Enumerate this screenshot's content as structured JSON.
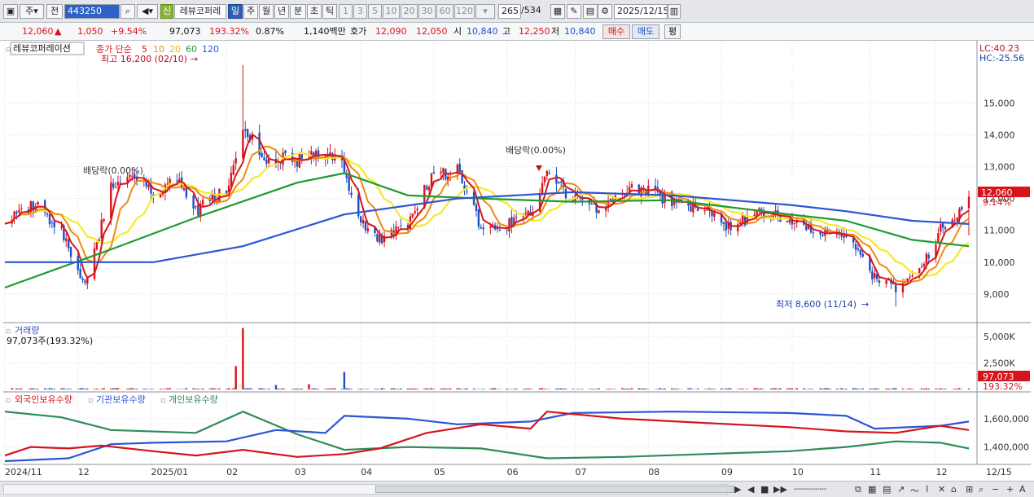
{
  "toolbar": {
    "market": "주",
    "prev": "전",
    "code": "443250",
    "new_badge": "신",
    "stock_name": "레뷰코퍼레",
    "periods": [
      "일",
      "주",
      "월",
      "년",
      "분",
      "초",
      "틱"
    ],
    "active_period": "일",
    "intervals": [
      "1",
      "3",
      "5",
      "10",
      "20",
      "30",
      "60",
      "120"
    ],
    "count": "265",
    "total": "/534",
    "date": "2025/12/15"
  },
  "quote": {
    "price": "12,060",
    "change": "1,050",
    "change_pct": "+9.54%",
    "volume": "97,073",
    "volume_ratio": "193.32%",
    "turnover_pct": "0.87%",
    "amount": "1,140백만",
    "ask_label": "호가",
    "ask1": "12,090",
    "ask2": "12,050",
    "open_label": "시",
    "open": "10,840",
    "high_label": "고",
    "high": "12,250",
    "low_label": "저",
    "low": "10,840",
    "buy_label": "매수",
    "sell_label": "매도",
    "flat_label": "평"
  },
  "colors": {
    "up": "#d7141b",
    "down": "#1f4fc4",
    "ma5": "#d7141b",
    "ma10": "#f08a0c",
    "ma20": "#f5ea2a",
    "ma60": "#1d9a34",
    "ma120": "#2d55d4",
    "foreign": "#d7141b",
    "institution": "#2d55d4",
    "individual": "#2e8b57"
  },
  "chart_data": [
    {
      "type": "candlestick",
      "title": "레뷰코퍼레이션",
      "legend_prefix": "종가 단순",
      "ma_periods": [
        "5",
        "10",
        "20",
        "60",
        "120"
      ],
      "y_ticks": [
        "9,000",
        "10,000",
        "11,000",
        "12,000",
        "13,000",
        "14,000",
        "15,000"
      ],
      "ylim": [
        8200,
        16400
      ],
      "current_price": "12,060",
      "current_change": "9.14%",
      "lc": "LC:40.23",
      "hc": "HC:-25.56",
      "annotations": {
        "high": "최고 16,200 (02/10)",
        "low": "최저 8,600 (11/14)",
        "dividend1": "배당락(0.00%)",
        "dividend2": "배당락(0.00%)"
      },
      "keypoints": [
        {
          "date": "2024-11-01",
          "close": 11400
        },
        {
          "date": "2024-11-14",
          "close": 11800
        },
        {
          "date": "2024-11-25",
          "close": 11000
        },
        {
          "date": "2024-12-05",
          "close": 9200
        },
        {
          "date": "2024-12-10",
          "close": 10600
        },
        {
          "date": "2024-12-16",
          "close": 12300
        },
        {
          "date": "2024-12-24",
          "close": 12600
        },
        {
          "date": "2025-01-03",
          "close": 12200
        },
        {
          "date": "2025-01-14",
          "close": 12700
        },
        {
          "date": "2025-01-21",
          "close": 11600
        },
        {
          "date": "2025-02-03",
          "close": 12300
        },
        {
          "date": "2025-02-10",
          "close": 14200
        },
        {
          "date": "2025-02-20",
          "close": 13300
        },
        {
          "date": "2025-03-05",
          "close": 13200
        },
        {
          "date": "2025-03-17",
          "close": 13500
        },
        {
          "date": "2025-03-25",
          "close": 12900
        },
        {
          "date": "2025-04-01",
          "close": 11300
        },
        {
          "date": "2025-04-09",
          "close": 10700
        },
        {
          "date": "2025-04-21",
          "close": 11200
        },
        {
          "date": "2025-04-29",
          "close": 12500
        },
        {
          "date": "2025-05-12",
          "close": 13000
        },
        {
          "date": "2025-05-22",
          "close": 11100
        },
        {
          "date": "2025-06-03",
          "close": 11200
        },
        {
          "date": "2025-06-12",
          "close": 11600
        },
        {
          "date": "2025-06-19",
          "close": 12800
        },
        {
          "date": "2025-06-30",
          "close": 12000
        },
        {
          "date": "2025-07-09",
          "close": 11700
        },
        {
          "date": "2025-07-21",
          "close": 12200
        },
        {
          "date": "2025-07-30",
          "close": 12300
        },
        {
          "date": "2025-08-11",
          "close": 11900
        },
        {
          "date": "2025-08-25",
          "close": 11600
        },
        {
          "date": "2025-09-05",
          "close": 11100
        },
        {
          "date": "2025-09-17",
          "close": 11600
        },
        {
          "date": "2025-09-30",
          "close": 11400
        },
        {
          "date": "2025-10-13",
          "close": 11000
        },
        {
          "date": "2025-10-24",
          "close": 10800
        },
        {
          "date": "2025-11-05",
          "close": 9500
        },
        {
          "date": "2025-11-14",
          "close": 9200
        },
        {
          "date": "2025-11-21",
          "close": 9500
        },
        {
          "date": "2025-11-28",
          "close": 10200
        },
        {
          "date": "2025-12-03",
          "close": 11000
        },
        {
          "date": "2025-12-09",
          "close": 11300
        },
        {
          "date": "2025-12-15",
          "close": 12060
        }
      ],
      "ma60_points": [
        {
          "date": "2024-11-01",
          "value": 9200
        },
        {
          "date": "2024-12-16",
          "value": 10400
        },
        {
          "date": "2025-01-21",
          "value": 11400
        },
        {
          "date": "2025-03-05",
          "value": 12500
        },
        {
          "date": "2025-03-25",
          "value": 12800
        },
        {
          "date": "2025-04-21",
          "value": 12100
        },
        {
          "date": "2025-05-22",
          "value": 12000
        },
        {
          "date": "2025-06-30",
          "value": 11900
        },
        {
          "date": "2025-08-11",
          "value": 11950
        },
        {
          "date": "2025-09-30",
          "value": 11500
        },
        {
          "date": "2025-10-24",
          "value": 11300
        },
        {
          "date": "2025-11-21",
          "value": 10700
        },
        {
          "date": "2025-12-15",
          "value": 10500
        }
      ],
      "ma120_points": [
        {
          "date": "2024-11-01",
          "value": 10000
        },
        {
          "date": "2025-01-03",
          "value": 10000
        },
        {
          "date": "2025-02-10",
          "value": 10500
        },
        {
          "date": "2025-03-25",
          "value": 11500
        },
        {
          "date": "2025-05-12",
          "value": 12000
        },
        {
          "date": "2025-06-30",
          "value": 12200
        },
        {
          "date": "2025-08-11",
          "value": 12100
        },
        {
          "date": "2025-09-30",
          "value": 11800
        },
        {
          "date": "2025-10-24",
          "value": 11600
        },
        {
          "date": "2025-11-21",
          "value": 11300
        },
        {
          "date": "2025-12-15",
          "value": 11200
        }
      ]
    },
    {
      "type": "bar",
      "title": "거래량",
      "label": "97,073주(193.32%)",
      "y_ticks": [
        "2,500K",
        "5,000K"
      ],
      "ylim": [
        0,
        6000000
      ],
      "current_value": "97,073",
      "current_ratio": "193.32%",
      "spikes": [
        {
          "date": "2025-02-10",
          "value": 5800000
        },
        {
          "date": "2025-02-07",
          "value": 2200000
        },
        {
          "date": "2025-03-25",
          "value": 1650000
        },
        {
          "date": "2025-03-10",
          "value": 500000
        },
        {
          "date": "2025-02-24",
          "value": 420000
        }
      ]
    },
    {
      "type": "line",
      "series": [
        {
          "name": "외국인보유수량"
        },
        {
          "name": "기관보유수량"
        },
        {
          "name": "개인보유수량"
        }
      ],
      "y_ticks": [
        "1,400,000",
        "1,600,000"
      ],
      "ylim": [
        1300000,
        1680000
      ],
      "foreign_points": [
        {
          "date": "2024-11-01",
          "value": 1340000
        },
        {
          "date": "2024-11-12",
          "value": 1400000
        },
        {
          "date": "2024-11-28",
          "value": 1390000
        },
        {
          "date": "2024-12-12",
          "value": 1410000
        },
        {
          "date": "2025-01-03",
          "value": 1370000
        },
        {
          "date": "2025-01-21",
          "value": 1340000
        },
        {
          "date": "2025-02-10",
          "value": 1380000
        },
        {
          "date": "2025-03-05",
          "value": 1330000
        },
        {
          "date": "2025-03-25",
          "value": 1350000
        },
        {
          "date": "2025-04-09",
          "value": 1390000
        },
        {
          "date": "2025-04-29",
          "value": 1500000
        },
        {
          "date": "2025-05-22",
          "value": 1560000
        },
        {
          "date": "2025-06-12",
          "value": 1530000
        },
        {
          "date": "2025-06-19",
          "value": 1650000
        },
        {
          "date": "2025-07-21",
          "value": 1600000
        },
        {
          "date": "2025-08-25",
          "value": 1570000
        },
        {
          "date": "2025-09-30",
          "value": 1540000
        },
        {
          "date": "2025-10-24",
          "value": 1510000
        },
        {
          "date": "2025-11-14",
          "value": 1500000
        },
        {
          "date": "2025-12-03",
          "value": 1550000
        },
        {
          "date": "2025-12-15",
          "value": 1520000
        }
      ],
      "institution_points": [
        {
          "date": "2024-11-01",
          "value": 1300000
        },
        {
          "date": "2024-11-28",
          "value": 1320000
        },
        {
          "date": "2024-12-16",
          "value": 1420000
        },
        {
          "date": "2025-01-03",
          "value": 1430000
        },
        {
          "date": "2025-02-03",
          "value": 1440000
        },
        {
          "date": "2025-02-24",
          "value": 1520000
        },
        {
          "date": "2025-03-17",
          "value": 1500000
        },
        {
          "date": "2025-03-25",
          "value": 1620000
        },
        {
          "date": "2025-04-21",
          "value": 1600000
        },
        {
          "date": "2025-05-12",
          "value": 1560000
        },
        {
          "date": "2025-06-12",
          "value": 1580000
        },
        {
          "date": "2025-06-30",
          "value": 1640000
        },
        {
          "date": "2025-08-11",
          "value": 1650000
        },
        {
          "date": "2025-09-30",
          "value": 1640000
        },
        {
          "date": "2025-10-24",
          "value": 1620000
        },
        {
          "date": "2025-11-05",
          "value": 1530000
        },
        {
          "date": "2025-12-03",
          "value": 1550000
        },
        {
          "date": "2025-12-15",
          "value": 1580000
        }
      ],
      "individual_points": [
        {
          "date": "2024-11-01",
          "value": 1650000
        },
        {
          "date": "2024-11-25",
          "value": 1610000
        },
        {
          "date": "2024-12-16",
          "value": 1520000
        },
        {
          "date": "2025-01-21",
          "value": 1500000
        },
        {
          "date": "2025-02-10",
          "value": 1650000
        },
        {
          "date": "2025-03-05",
          "value": 1490000
        },
        {
          "date": "2025-03-25",
          "value": 1380000
        },
        {
          "date": "2025-04-21",
          "value": 1400000
        },
        {
          "date": "2025-05-22",
          "value": 1390000
        },
        {
          "date": "2025-06-19",
          "value": 1320000
        },
        {
          "date": "2025-07-21",
          "value": 1330000
        },
        {
          "date": "2025-08-25",
          "value": 1350000
        },
        {
          "date": "2025-09-30",
          "value": 1370000
        },
        {
          "date": "2025-10-24",
          "value": 1400000
        },
        {
          "date": "2025-11-14",
          "value": 1440000
        },
        {
          "date": "2025-12-03",
          "value": 1430000
        },
        {
          "date": "2025-12-15",
          "value": 1390000
        }
      ]
    }
  ],
  "x_axis": {
    "ticks": [
      {
        "date": "2024-11-01",
        "label": "2024/11"
      },
      {
        "date": "2024-12-02",
        "label": "12"
      },
      {
        "date": "2025-01-02",
        "label": "2025/01"
      },
      {
        "date": "2025-02-03",
        "label": "02"
      },
      {
        "date": "2025-03-04",
        "label": "03"
      },
      {
        "date": "2025-04-01",
        "label": "04"
      },
      {
        "date": "2025-05-02",
        "label": "05"
      },
      {
        "date": "2025-06-02",
        "label": "06"
      },
      {
        "date": "2025-07-01",
        "label": "07"
      },
      {
        "date": "2025-08-01",
        "label": "08"
      },
      {
        "date": "2025-09-01",
        "label": "09"
      },
      {
        "date": "2025-10-01",
        "label": "10"
      },
      {
        "date": "2025-11-03",
        "label": "11"
      },
      {
        "date": "2025-12-01",
        "label": "12"
      }
    ],
    "end_label": "12/15"
  }
}
